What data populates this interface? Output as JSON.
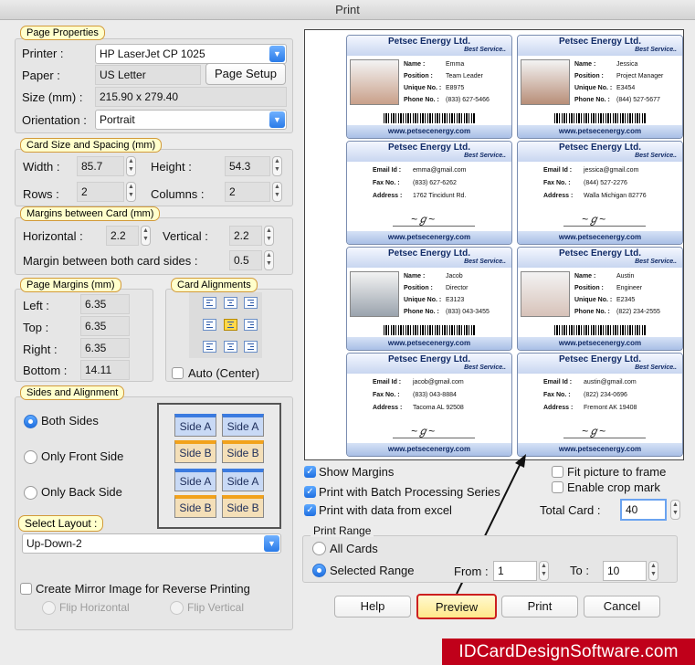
{
  "window": {
    "title": "Print"
  },
  "page_properties": {
    "legend": "Page Properties",
    "printer_label": "Printer :",
    "printer_value": "HP LaserJet CP 1025",
    "paper_label": "Paper :",
    "paper_value": "US Letter",
    "page_setup_button": "Page Setup",
    "size_label": "Size (mm) :",
    "size_value": "215.90 x 279.40",
    "orientation_label": "Orientation :",
    "orientation_value": "Portrait"
  },
  "card_size": {
    "legend": "Card Size and Spacing (mm)",
    "width_label": "Width :",
    "width_value": "85.7",
    "height_label": "Height :",
    "height_value": "54.3",
    "rows_label": "Rows :",
    "rows_value": "2",
    "columns_label": "Columns :",
    "columns_value": "2"
  },
  "margins_between": {
    "legend": "Margins between Card (mm)",
    "horizontal_label": "Horizontal :",
    "horizontal_value": "2.2",
    "vertical_label": "Vertical :",
    "vertical_value": "2.2",
    "both_label": "Margin between both card sides :",
    "both_value": "0.5"
  },
  "page_margins": {
    "legend": "Page Margins (mm)",
    "left_label": "Left :",
    "left_value": "6.35",
    "top_label": "Top :",
    "top_value": "6.35",
    "right_label": "Right :",
    "right_value": "6.35",
    "bottom_label": "Bottom :",
    "bottom_value": "14.11"
  },
  "card_alignments": {
    "legend": "Card Alignments",
    "auto_label": "Auto (Center)",
    "selected": "middle-center"
  },
  "sides": {
    "legend": "Sides and Alignment",
    "both": "Both Sides",
    "front": "Only Front Side",
    "back": "Only Back Side",
    "selected": "both",
    "tiles": [
      "Side A",
      "Side A",
      "Side B",
      "Side B",
      "Side A",
      "Side A",
      "Side B",
      "Side B"
    ]
  },
  "layout": {
    "legend": "Select Layout :",
    "value": "Up-Down-2"
  },
  "mirror": {
    "label": "Create Mirror Image for Reverse Printing",
    "flip_h": "Flip Horizontal",
    "flip_v": "Flip Vertical"
  },
  "options": {
    "show_margins": "Show Margins",
    "batch": "Print with Batch Processing Series",
    "excel": "Print with data from excel",
    "fit": "Fit picture to frame",
    "crop": "Enable crop mark",
    "total_label": "Total Card :",
    "total_value": "40"
  },
  "print_range": {
    "legend": "Print Range",
    "all": "All Cards",
    "selected": "Selected Range",
    "from_label": "From :",
    "from_value": "1",
    "to_label": "To :",
    "to_value": "10"
  },
  "buttons": {
    "help": "Help",
    "preview": "Preview",
    "print": "Print",
    "cancel": "Cancel"
  },
  "preview_cards": {
    "company": "Petsec Energy Ltd.",
    "tagline": "Best Service..",
    "website": "www.petsecenergy.com",
    "front_labels": {
      "name": "Name :",
      "position": "Position :",
      "unique": "Unique No. :",
      "phone": "Phone No. :"
    },
    "back_labels": {
      "email": "Email Id :",
      "fax": "Fax No. :",
      "address": "Address :"
    },
    "people": [
      {
        "name": "Emma",
        "position": "Team Leader",
        "unique": "E8975",
        "phone": "(833) 627-5466",
        "email": "emma@gmail.com",
        "fax": "(833) 627-6262",
        "address": "1762 Tincidunt Rd."
      },
      {
        "name": "Jessica",
        "position": "Project Manager",
        "unique": "E3454",
        "phone": "(844) 527-5677",
        "email": "jessica@gmail.com",
        "fax": "(844) 527-2276",
        "address": "Walla Michigan 82776"
      },
      {
        "name": "Jacob",
        "position": "Director",
        "unique": "E3123",
        "phone": "(833) 043-3455",
        "email": "jacob@gmail.com",
        "fax": "(833) 043-8884",
        "address": "Tacoma AL 92508"
      },
      {
        "name": "Austin",
        "position": "Engineer",
        "unique": "E2345",
        "phone": "(822) 234-2555",
        "email": "austin@gmail.com",
        "fax": "(822) 234-0696",
        "address": "Fremont AK 19408"
      }
    ]
  },
  "watermark": "IDCardDesignSoftware.com"
}
